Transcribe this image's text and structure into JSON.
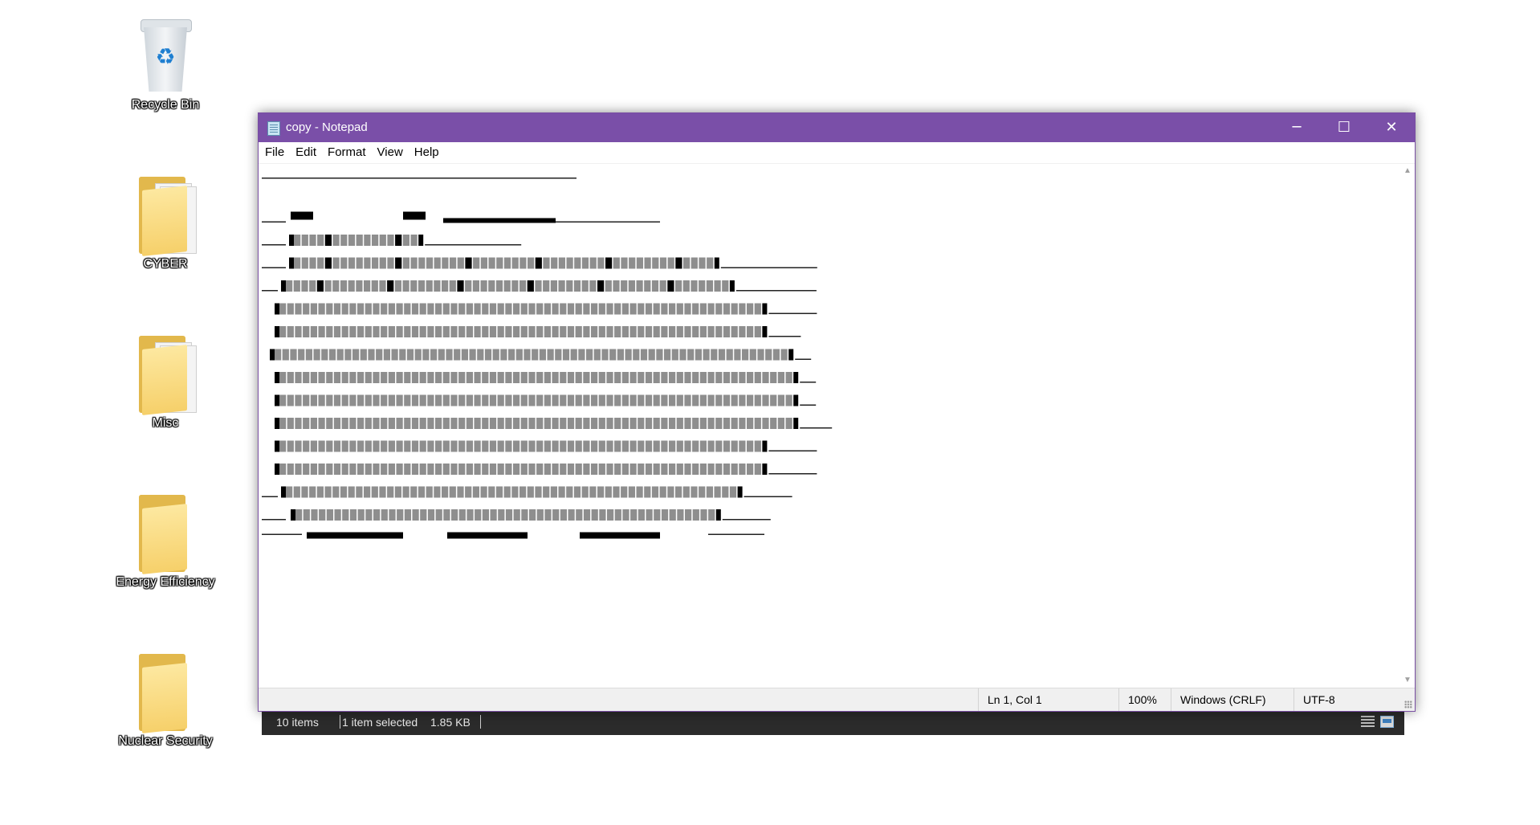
{
  "desktop": {
    "icons": [
      {
        "label": "Recycle Bin",
        "icon": "recycle-bin-icon"
      },
      {
        "label": "CYBER",
        "icon": "folder-icon"
      },
      {
        "label": "Misc",
        "icon": "folder-icon"
      },
      {
        "label": "Energy Efficiency",
        "icon": "folder-icon"
      },
      {
        "label": "Nuclear Security",
        "icon": "folder-icon"
      }
    ]
  },
  "window": {
    "title": "copy - Notepad",
    "title_color": "#7a4fa8",
    "controls": {
      "minimize": "─",
      "maximize": "☐",
      "close": "✕"
    },
    "menu": [
      "File",
      "Edit",
      "Format",
      "View",
      "Help"
    ],
    "content_description_none": "",
    "status": {
      "position": "Ln 1, Col 1",
      "zoom": "100%",
      "line_ending": "Windows (CRLF)",
      "encoding": "UTF-8"
    }
  },
  "explorer_status": {
    "items": "10 items",
    "selection": "1 item selected",
    "size": "1.85 KB"
  }
}
